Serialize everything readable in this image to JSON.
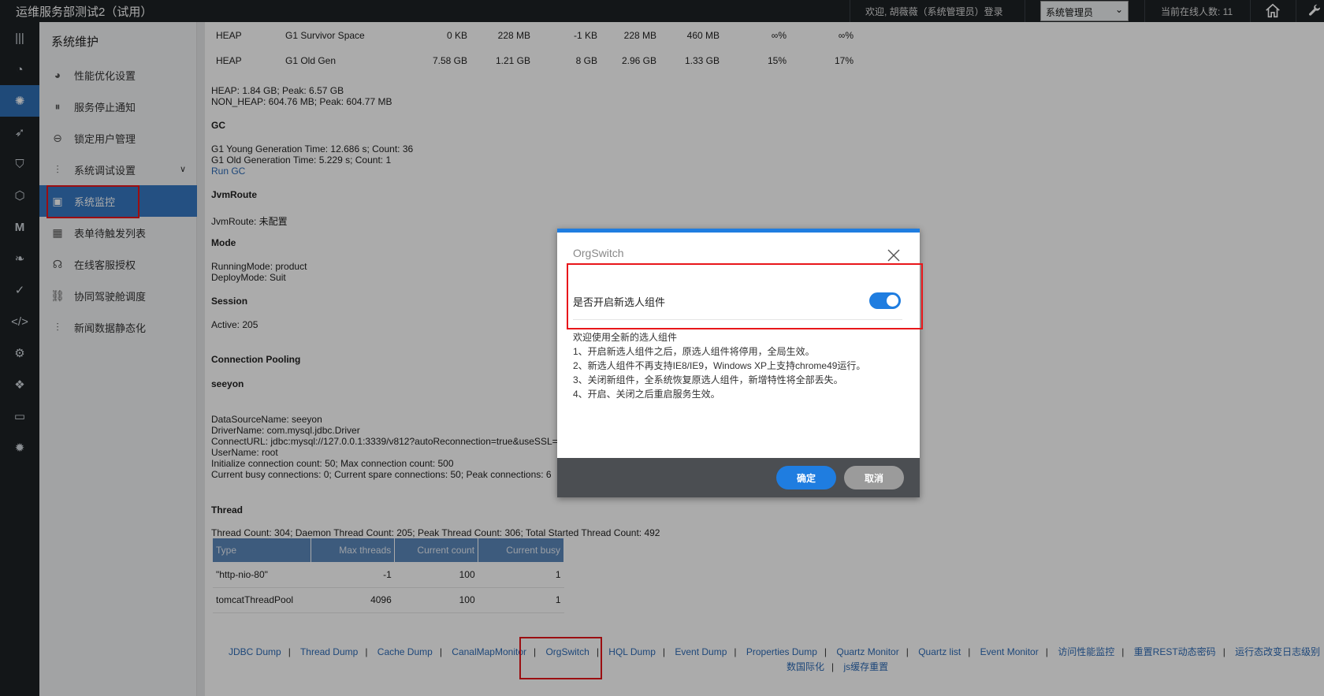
{
  "header": {
    "app_title": "运维服务部测试2（试用）",
    "welcome": "欢迎, 胡薇薇（系统管理员）登录",
    "role_select_value": "系统管理员",
    "online_count": "当前在线人数: 11"
  },
  "sidebar": {
    "title": "系统维护",
    "items": [
      {
        "label": "性能优化设置"
      },
      {
        "label": "服务停止通知"
      },
      {
        "label": "锁定用户管理"
      },
      {
        "label": "系统调试设置"
      },
      {
        "label": "系统监控"
      },
      {
        "label": "表单待触发列表"
      },
      {
        "label": "在线客服授权"
      },
      {
        "label": "协同驾驶舱调度"
      },
      {
        "label": "新闻数据静态化"
      }
    ]
  },
  "main": {
    "heap_rows": [
      [
        "HEAP",
        "G1 Survivor Space",
        "0 KB",
        "228 MB",
        "-1 KB",
        "228 MB",
        "460 MB",
        "∞%",
        "∞%"
      ],
      [
        "HEAP",
        "G1 Old Gen",
        "7.58 GB",
        "1.21 GB",
        "8 GB",
        "2.96 GB",
        "1.33 GB",
        "15%",
        "17%"
      ]
    ],
    "heap_summary": "HEAP: 1.84 GB; Peak: 6.57 GB",
    "nonheap_summary": "NON_HEAP: 604.76 MB; Peak: 604.77 MB",
    "gc_title": "GC",
    "gc_young": "G1 Young Generation  Time: 12.686 s; Count: 36",
    "gc_old": "G1 Old Generation  Time: 5.229 s; Count: 1",
    "run_gc": "Run GC",
    "jvmroute_title": "JvmRoute",
    "jvmroute_value": "JvmRoute: 未配置",
    "mode_title": "Mode",
    "running_mode": "RunningMode: product",
    "deploy_mode": "DeployMode: Suit",
    "session_title": "Session",
    "session_active": "Active: 205",
    "pool_title": "Connection Pooling",
    "pool_name": "seeyon",
    "ds_name": "DataSourceName: seeyon",
    "driver": "DriverName: com.mysql.jdbc.Driver",
    "connect_url": "ConnectURL: jdbc:mysql://127.0.0.1:3339/v812?autoReconnection=true&useSSL=",
    "username": "UserName: root",
    "init_conn": "Initialize connection count: 50; Max connection count: 500",
    "busy_conn": "Current busy connections: 0; Current spare connections: 50; Peak connections: 6",
    "thread_title": "Thread",
    "thread_summary": "Thread Count: 304; Daemon Thread Count: 205; Peak Thread Count: 306; Total Started Thread Count: 492",
    "thread_table": {
      "headers": [
        "Type",
        "Max threads",
        "Current count",
        "Current busy"
      ],
      "rows": [
        [
          "\"http-nio-80\"",
          "-1",
          "100",
          "1"
        ],
        [
          "tomcatThreadPool",
          "4096",
          "100",
          "1"
        ]
      ]
    }
  },
  "footer_links": {
    "row1": [
      "JDBC Dump",
      "Thread Dump",
      "Cache Dump",
      "CanalMapMonitor",
      "OrgSwitch",
      "HQL Dump",
      "Event Dump",
      "Properties Dump",
      "Quartz Monitor",
      "Quartz list",
      "Event Monitor",
      "访问性能监控",
      "重置REST动态密码",
      "运行态改变日志级别"
    ],
    "row2": [
      "数国际化",
      "js缓存重置"
    ]
  },
  "dialog": {
    "title": "OrgSwitch",
    "setting_label": "是否开启新选人组件",
    "toggle_on": true,
    "desc": [
      "欢迎使用全新的选人组件",
      "1、开启新选人组件之后，原选人组件将停用，全局生效。",
      "2、新选人组件不再支持IE8/IE9，Windows XP上支持chrome49运行。",
      "3、关闭新组件，全系统恢复原选人组件，新增特性将全部丢失。",
      "4、开启、关闭之后重启服务生效。"
    ],
    "ok_label": "确定",
    "cancel_label": "取消"
  },
  "colors": {
    "accent": "#1f7de0",
    "highlight": "#e8161a",
    "topbar": "#1d2125",
    "sidebar_active": "#3778c2"
  }
}
